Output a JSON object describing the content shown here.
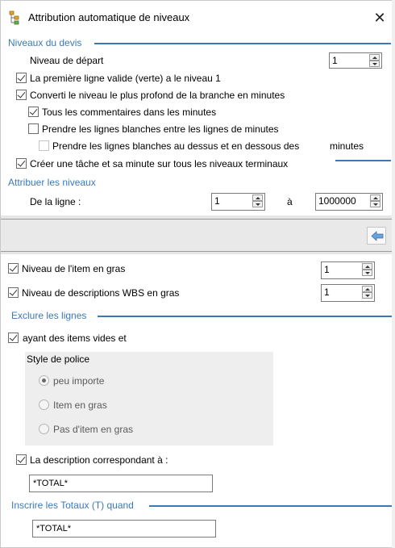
{
  "window": {
    "title": "Attribution automatique de niveaux",
    "close_glyph": "✕",
    "icon": "tree-levels-icon"
  },
  "niveaux_devis": {
    "section_title": "Niveaux du devis",
    "niveau_depart_label": "Niveau de départ",
    "niveau_depart_value": "1",
    "premiere_ligne_label": "La première ligne valide (verte) a  le niveau 1",
    "premiere_ligne_checked": true,
    "convertir_label": "Converti le niveau le plus profond de la branche en minutes",
    "convertir_checked": true,
    "tous_commentaires_label": "Tous les commentaires dans les minutes",
    "tous_commentaires_checked": true,
    "lignes_blanches_label": "Prendre les lignes blanches entre les lignes de minutes",
    "lignes_blanches_checked": false,
    "lignes_blanches_dessus_label": "Prendre les lignes blanches au dessus et en dessous des",
    "lignes_blanches_dessus_suffix": "minutes",
    "lignes_blanches_dessus_checked": false,
    "creer_tache_label": "Créer une tâche et sa minute sur tous les niveaux terminaux",
    "creer_tache_checked": true
  },
  "attribuer": {
    "section_title": "Attribuer les niveaux",
    "de_la_ligne_label": "De la ligne :",
    "from_value": "1",
    "a_label": "à",
    "to_value": "1000000"
  },
  "toolbar": {
    "apply_icon": "arrow-left-icon"
  },
  "gras": {
    "item_gras_label": "Niveau de l'item en gras",
    "item_gras_checked": true,
    "item_gras_value": "1",
    "wbs_gras_label": "Niveau de descriptions WBS en gras",
    "wbs_gras_checked": true,
    "wbs_gras_value": "1"
  },
  "exclure": {
    "section_title": "Exclure les lignes",
    "items_vides_label": "ayant des items vides et",
    "items_vides_checked": true,
    "style_police_title": "Style de police",
    "options": [
      "peu importe",
      "Item en gras",
      "Pas d'item en gras"
    ],
    "selected_option": "peu importe",
    "description_label": "La description correspondant à :",
    "description_checked": true,
    "description_value": "*TOTAL*"
  },
  "totaux": {
    "section_title": "Inscrire les Totaux (T) quand",
    "value": "*TOTAL*"
  },
  "colors": {
    "accent": "#3c79b4",
    "panel_gray": "#e6e6e6",
    "group_gray": "#eeeeee"
  }
}
